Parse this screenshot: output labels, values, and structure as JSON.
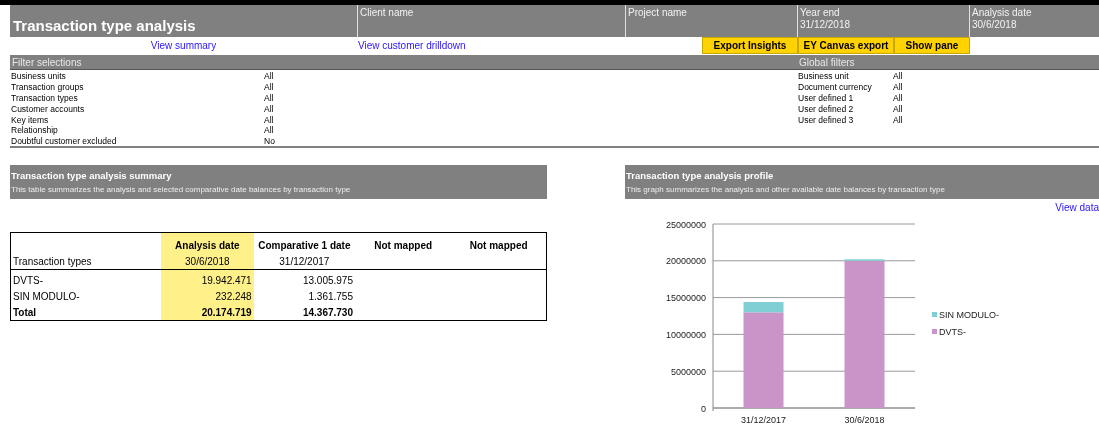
{
  "header": {
    "title": "Transaction type analysis",
    "fields": [
      {
        "label": "Client name"
      },
      {
        "label": "Project name"
      },
      {
        "label": "Year end",
        "value": "31/12/2018"
      },
      {
        "label": "Analysis date",
        "value": "30/6/2018"
      }
    ]
  },
  "nav_links": [
    "View summary",
    "View customer drilldown"
  ],
  "buttons": [
    "Export Insights",
    "EY Canvas export",
    "Show pane"
  ],
  "filter_selections": {
    "title": "Filter selections",
    "items": [
      {
        "label": "Business units",
        "value": "All"
      },
      {
        "label": "Transaction groups",
        "value": "All"
      },
      {
        "label": "Transaction types",
        "value": "All"
      },
      {
        "label": "Customer accounts",
        "value": "All"
      },
      {
        "label": "Key items",
        "value": "All"
      },
      {
        "label": "Relationship",
        "value": "All"
      },
      {
        "label": "Doubtful customer excluded",
        "value": "No"
      }
    ]
  },
  "global_filters": {
    "title": "Global filters",
    "items": [
      {
        "label": "Business unit",
        "value": "All"
      },
      {
        "label": "Document currency",
        "value": "All"
      },
      {
        "label": "User defined 1",
        "value": "All"
      },
      {
        "label": "User defined 2",
        "value": "All"
      },
      {
        "label": "User defined 3",
        "value": "All"
      }
    ]
  },
  "summary": {
    "title": "Transaction type analysis summary",
    "description": "This table summarizes  the analysis and selected comparative date balances by transaction type",
    "columns": [
      {
        "sublabel": "Transaction types",
        "highlighted": false
      },
      {
        "label": "Analysis date",
        "sublabel": "30/6/2018",
        "highlighted": true
      },
      {
        "label": "Comparative 1 date",
        "sublabel": "31/12/2017",
        "highlighted": false
      },
      {
        "label": "Not mapped",
        "highlighted": false
      },
      {
        "label": "Not mapped",
        "highlighted": false
      }
    ],
    "rows": [
      {
        "kind": "item",
        "cells": [
          "DVTS-",
          "19.942.471",
          "13.005.975"
        ]
      },
      {
        "kind": "item",
        "cells": [
          "SIN MODULO-",
          "232.248",
          "1.361.755"
        ]
      },
      {
        "kind": "total",
        "cells": [
          "Total",
          "20.174.719",
          "14.367.730"
        ]
      }
    ]
  },
  "profile": {
    "title": "Transaction type analysis profile",
    "description": "This graph summarizes the analysis and other available date balances by transaction type",
    "link": "View data",
    "chart_data": {
      "type": "bar",
      "stacked": true,
      "grid": true,
      "legend": true,
      "categories": [
        "31/12/2017",
        "30/6/2018"
      ],
      "ylim": [
        0,
        25000000
      ],
      "yticks": [
        0,
        5000000,
        10000000,
        15000000,
        20000000,
        25000000
      ],
      "series": [
        {
          "name": "DVTS-",
          "color": "#c994c7",
          "values": [
            13000000,
            20000000
          ]
        },
        {
          "name": "SIN MODULO-",
          "color": "#7fcfd4",
          "values": [
            1400000,
            200000
          ]
        }
      ]
    }
  }
}
